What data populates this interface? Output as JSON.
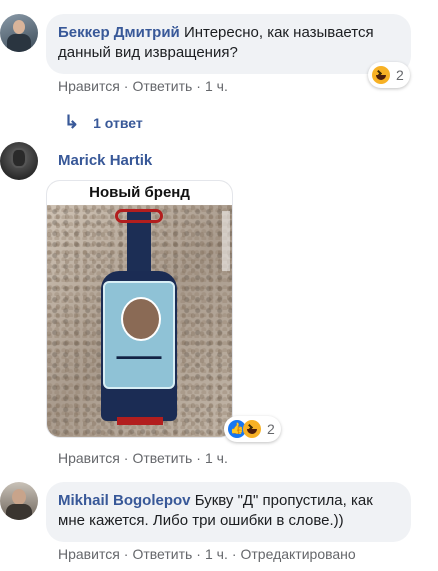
{
  "comments": [
    {
      "author": "Беккер Дмитрий",
      "text": "Интересно, как называется данный вид извращения?",
      "reaction_count": "2",
      "reaction_icons": [
        "haha-icon"
      ],
      "actions": {
        "like": "Нравится",
        "reply": "Ответить",
        "time": "1 ч."
      },
      "replies_label": "1 ответ"
    },
    {
      "author": "Marick Hartik",
      "image_caption": "Новый бренд",
      "reaction_count": "2",
      "reaction_icons": [
        "like-icon",
        "haha-icon"
      ],
      "actions": {
        "like": "Нравится",
        "reply": "Ответить",
        "time": "1 ч."
      }
    },
    {
      "author": "Mikhail Bogolepov",
      "text": "Букву \"Д\" пропустила, как мне кажется. Либо три ошибки в слове.))",
      "actions": {
        "like": "Нравится",
        "reply": "Ответить",
        "time": "1 ч.",
        "edited": "Отредактировано"
      }
    }
  ],
  "separator": "·",
  "colors": {
    "link": "#385898",
    "bubble": "#f0f2f5",
    "muted": "#65676b"
  }
}
